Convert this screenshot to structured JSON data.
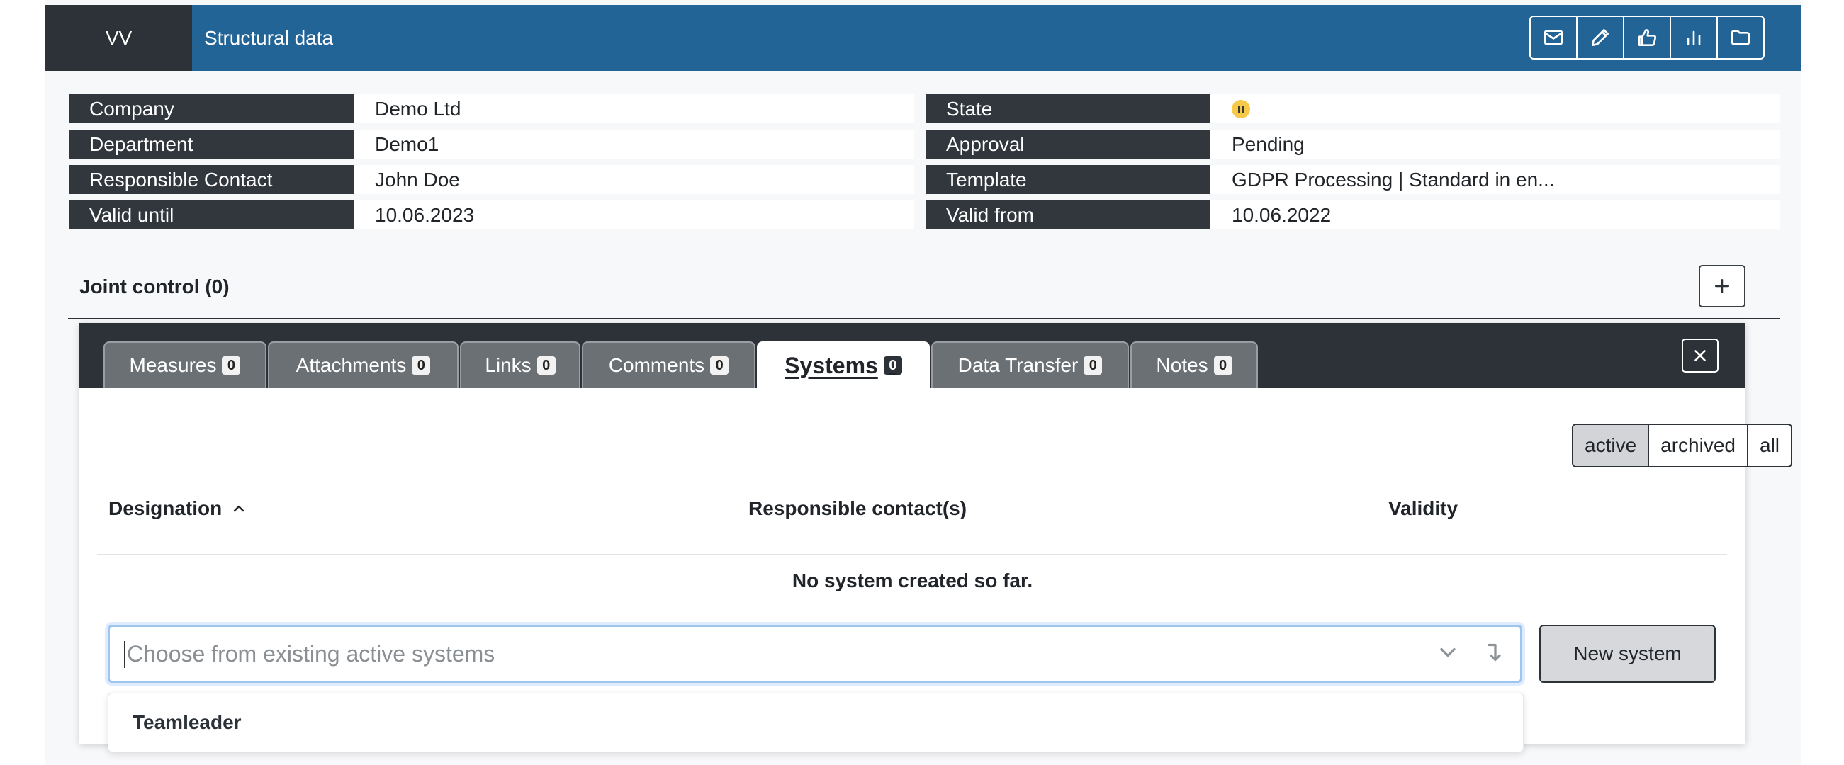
{
  "header": {
    "badge": "VV",
    "title": "Structural data",
    "tools": [
      "mail-icon",
      "pencil-icon",
      "thumbs-up-icon",
      "bar-chart-icon",
      "folder-icon"
    ]
  },
  "info": {
    "company_label": "Company",
    "company_value": "Demo Ltd",
    "department_label": "Department",
    "department_value": "Demo1",
    "contact_label": "Responsible Contact",
    "contact_value": "John Doe",
    "valid_until_label": "Valid until",
    "valid_until_value": "10.06.2023",
    "state_label": "State",
    "state_icon": "pause-icon",
    "approval_label": "Approval",
    "approval_value": "Pending",
    "template_label": "Template",
    "template_value": "GDPR Processing | Standard in en...",
    "valid_from_label": "Valid from",
    "valid_from_value": "10.06.2022"
  },
  "joint_control": {
    "title": "Joint control (0)"
  },
  "tabs": [
    {
      "label": "Measures",
      "count": "0"
    },
    {
      "label": "Attachments",
      "count": "0"
    },
    {
      "label": "Links",
      "count": "0"
    },
    {
      "label": "Comments",
      "count": "0"
    },
    {
      "label": "Systems",
      "count": "0",
      "active": true
    },
    {
      "label": "Data Transfer",
      "count": "0"
    },
    {
      "label": "Notes",
      "count": "0"
    }
  ],
  "filter": {
    "active": "active",
    "archived": "archived",
    "all": "all",
    "selected": "active"
  },
  "table": {
    "col_designation": "Designation",
    "col_contacts": "Responsible contact(s)",
    "col_validity": "Validity",
    "empty_message": "No system created so far."
  },
  "system_select": {
    "placeholder": "Choose from existing active systems",
    "value": ""
  },
  "new_system_label": "New system",
  "dropdown_options": [
    "Teamleader"
  ],
  "colors": {
    "header": "#236496",
    "dark": "#2c3238",
    "state": "#f7c948"
  }
}
